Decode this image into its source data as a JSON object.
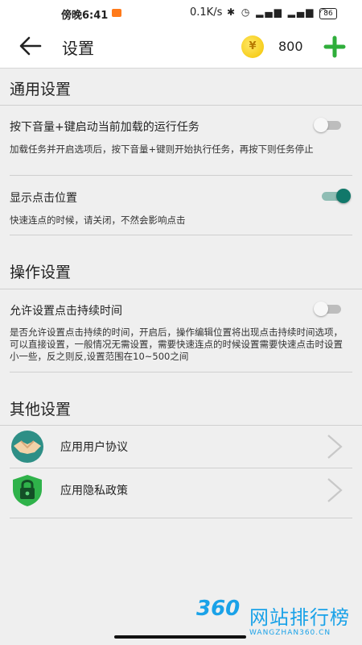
{
  "status": {
    "time": "傍晚6:41",
    "speed": "0.1K/s",
    "battery": "86"
  },
  "appbar": {
    "title": "设置",
    "coin_symbol": "¥",
    "coins": "800"
  },
  "general": {
    "title": "通用设置",
    "volume_start": {
      "label": "按下音量+键启动当前加载的运行任务",
      "desc": "加载任务并开启选项后，按下音量+键则开始执行任务，再按下则任务停止",
      "enabled": false
    },
    "show_click": {
      "label": "显示点击位置",
      "desc": "快速连点的时候，请关闭，不然会影响点击",
      "enabled": true
    }
  },
  "operation": {
    "title": "操作设置",
    "duration": {
      "label": "允许设置点击持续时间",
      "desc": "是否允许设置点击持续的时间，开启后，操作编辑位置将出现点击持续时间选项，可以直接设置，一般情况无需设置，需要快速连点的时候设置需要快速点击时设置小一些，反之则反,设置范围在10~500之间",
      "enabled": false
    }
  },
  "other": {
    "title": "其他设置",
    "items": [
      {
        "label": "应用用户协议"
      },
      {
        "label": "应用隐私政策"
      }
    ]
  },
  "watermark": {
    "logo": "360",
    "name": "网站排行榜",
    "url": "WANGZHAN360.CN"
  },
  "colors": {
    "accent": "#11786a",
    "coin": "#f3c300",
    "add": "#2fae3b"
  }
}
